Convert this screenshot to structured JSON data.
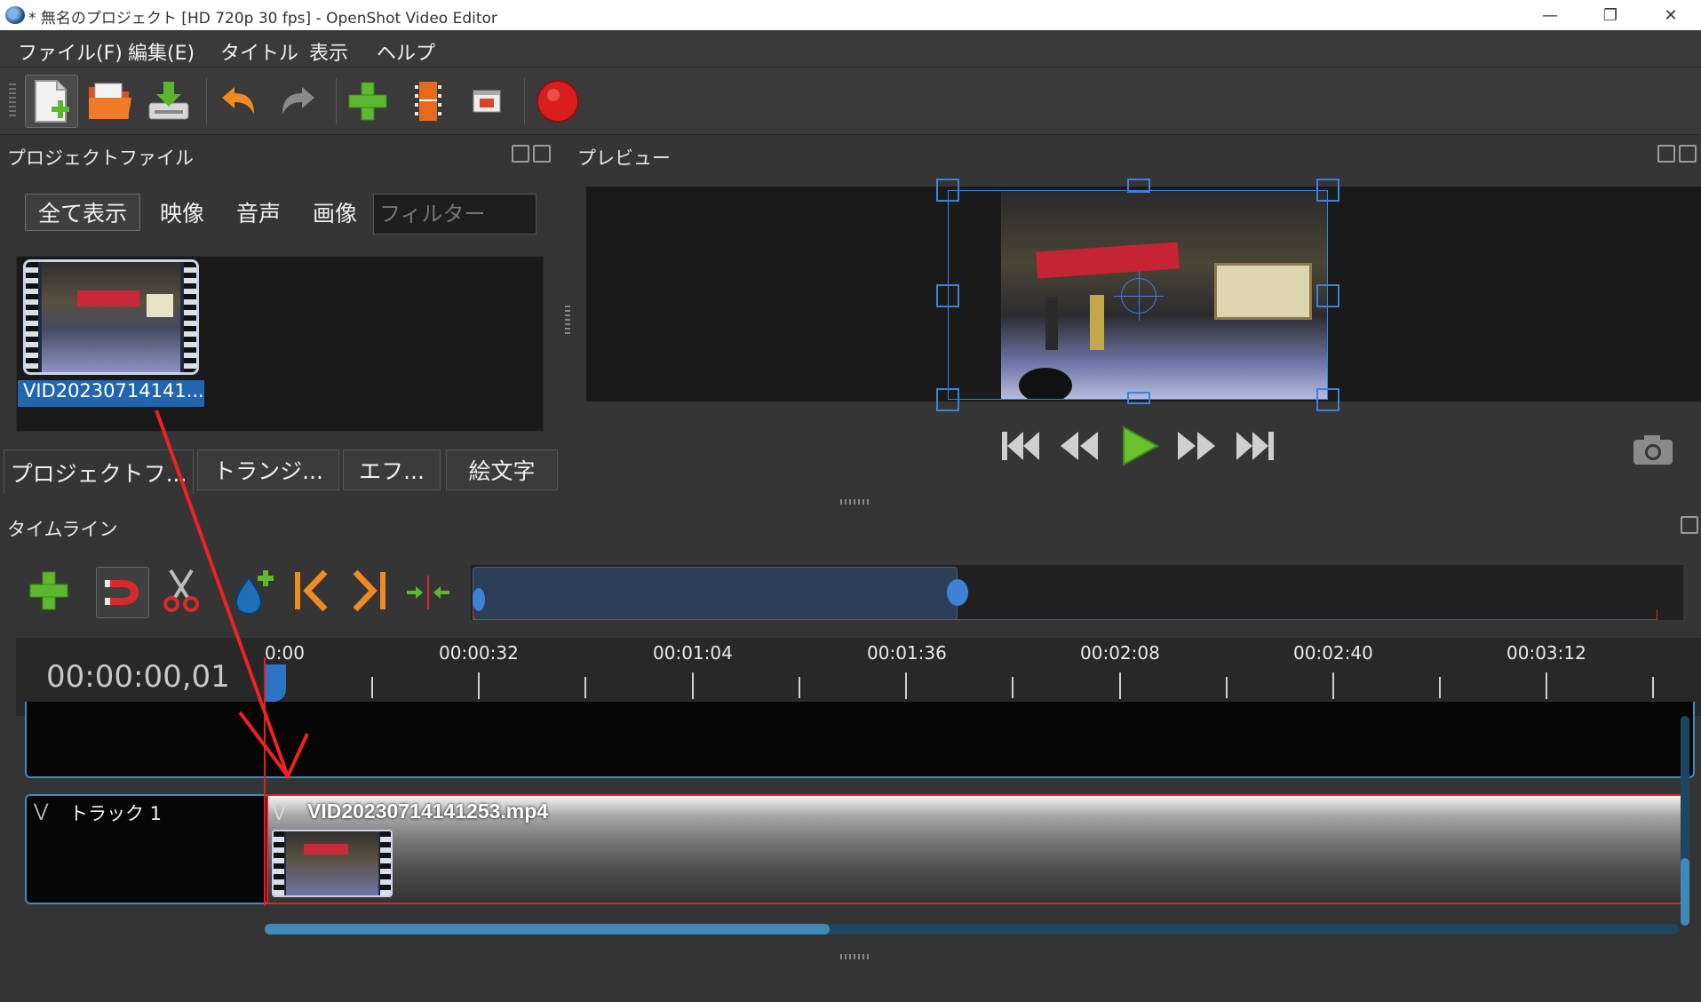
{
  "window": {
    "title": "* 無名のプロジェクト [HD 720p 30 fps] - OpenShot Video Editor",
    "minimize_glyph": "—",
    "maximize_glyph": "❐",
    "close_glyph": "✕"
  },
  "menu": {
    "items": [
      {
        "label": "ファイル(F)"
      },
      {
        "label": "編集(E)"
      },
      {
        "label": "タイトル"
      },
      {
        "label": "表示"
      },
      {
        "label": "ヘルプ"
      }
    ]
  },
  "toolbar": {
    "icons": [
      "new-project-icon",
      "open-project-icon",
      "save-project-icon",
      "undo-icon",
      "redo-icon",
      "import-files-icon",
      "choose-profile-icon",
      "fullscreen-icon",
      "export-video-icon"
    ]
  },
  "project_files": {
    "title": "プロジェクトファイル",
    "filters": {
      "all": "全て表示",
      "video": "映像",
      "audio": "音声",
      "image": "画像"
    },
    "filter_placeholder": "フィルター",
    "items": [
      {
        "label": "VID20230714141..."
      }
    ]
  },
  "tabs": {
    "project_files": "プロジェクトフ...",
    "transitions": "トランジ...",
    "effects": "エフ...",
    "emoji": "絵文字"
  },
  "preview": {
    "title": "プレビュー"
  },
  "timeline": {
    "title": "タイムライン",
    "timecode": "00:00:00,01",
    "ruler_labels": [
      "0:00",
      "00:00:32",
      "00:01:04",
      "00:01:36",
      "00:02:08",
      "00:02:40",
      "00:03:12"
    ],
    "track_name": "トラック 1",
    "clip_name": "VID20230714141253.mp4",
    "tools": [
      "add-track-icon",
      "snap-icon",
      "razor-icon",
      "add-marker-icon",
      "previous-marker-icon",
      "next-marker-icon",
      "center-playhead-icon"
    ]
  },
  "colors": {
    "accent_blue": "#2266b0",
    "playhead_red": "#e02020",
    "track_border": "#3c8cc0",
    "record_red": "#d81f1f"
  }
}
